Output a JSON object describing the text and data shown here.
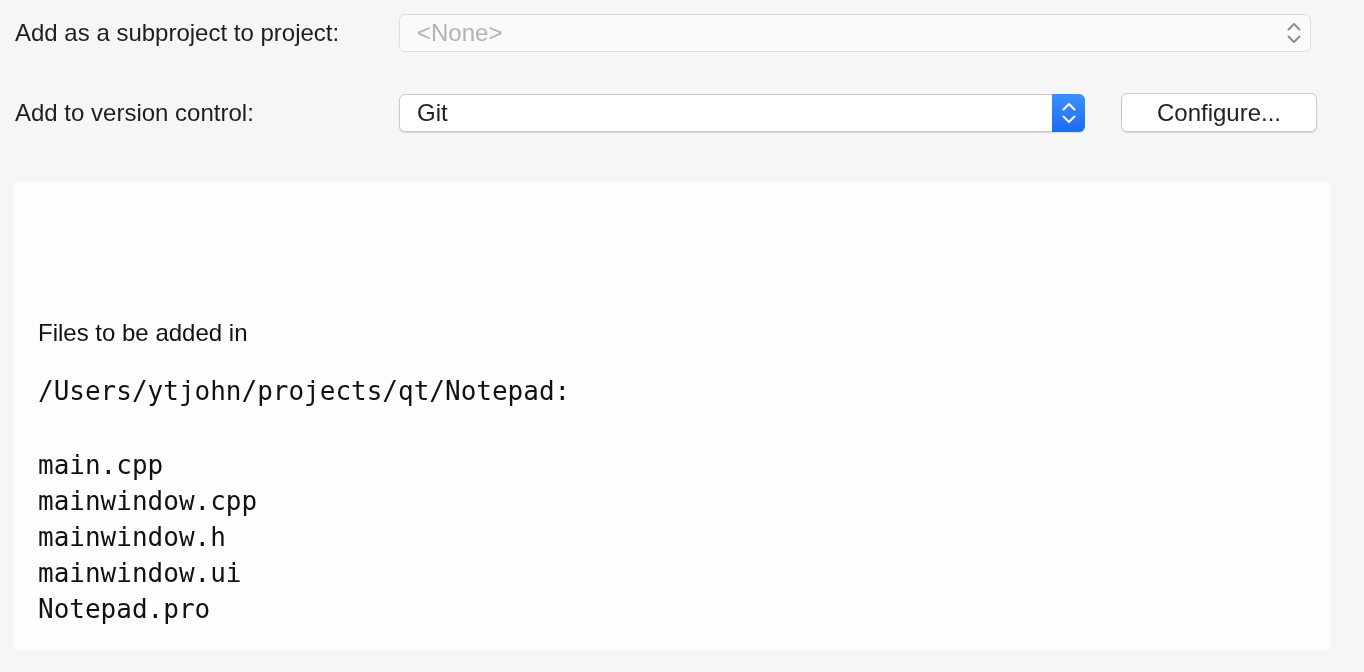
{
  "form": {
    "fields": [
      {
        "kind": "select",
        "label": "Add as a subproject to project:",
        "value": "<None>",
        "disabled": true
      },
      {
        "kind": "select",
        "label": "Add to version control:",
        "value": "Git",
        "disabled": false,
        "button": "Configure..."
      }
    ]
  },
  "summary": {
    "heading": "Files to be added in",
    "path": "/Users/ytjohn/projects/qt/Notepad:",
    "files": [
      "main.cpp",
      "mainwindow.cpp",
      "mainwindow.h",
      "mainwindow.ui",
      "Notepad.pro"
    ]
  }
}
